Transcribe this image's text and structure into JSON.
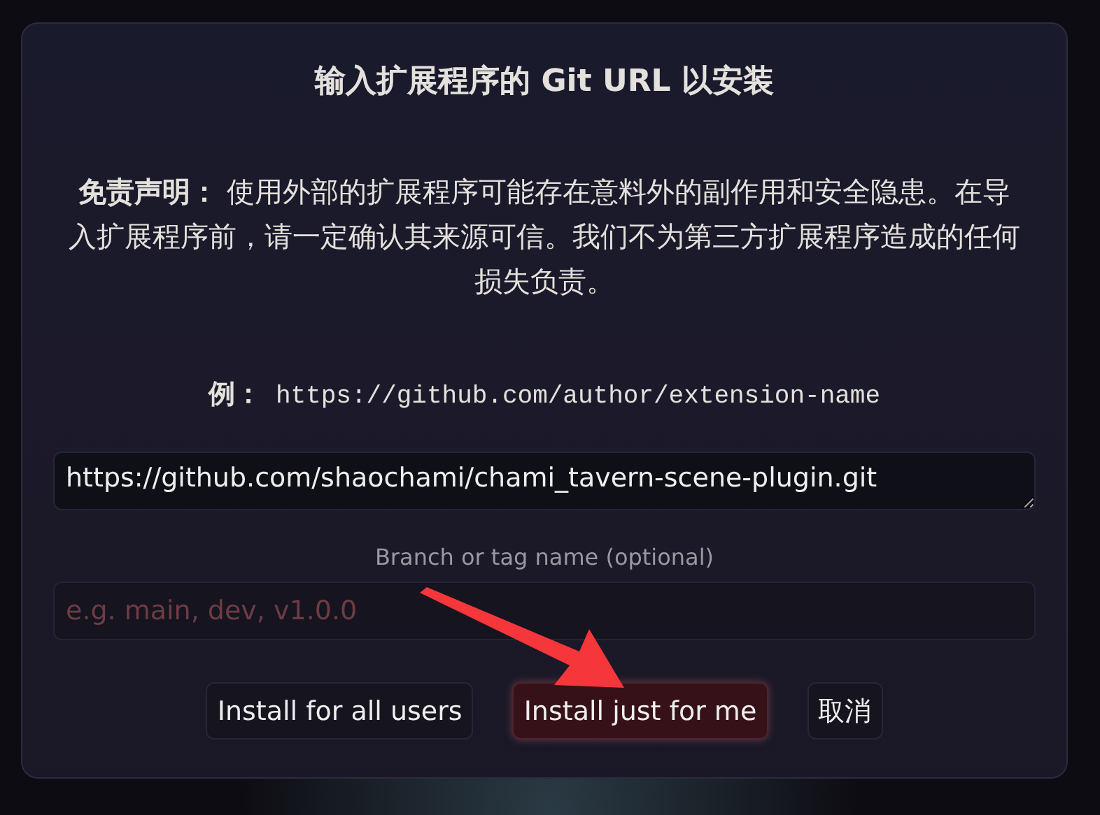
{
  "dialog": {
    "title": "输入扩展程序的 Git URL 以安装",
    "disclaimer": "**免责声明：** 使用外部的扩展程序可能存在意料外的副作用和安全隐患。在导入扩展程序前，请一定确认其来源可信。我们不为第三方扩展程序造成的任何损失负责。",
    "example_label": "例：",
    "example_url": "https://github.com/author/extension-name",
    "url_field": {
      "value": "https://github.com/shaochami/chami_tavern-scene-plugin.git"
    },
    "branch_label": "Branch or tag name (optional)",
    "branch_field": {
      "placeholder": "e.g. main, dev, v1.0.0"
    },
    "buttons": [
      {
        "label": "Install for all users",
        "kind": "default"
      },
      {
        "label": "Install just for me",
        "kind": "accent"
      },
      {
        "label": "取消",
        "kind": "default"
      }
    ]
  },
  "annotation": {
    "kind": "arrow"
  }
}
